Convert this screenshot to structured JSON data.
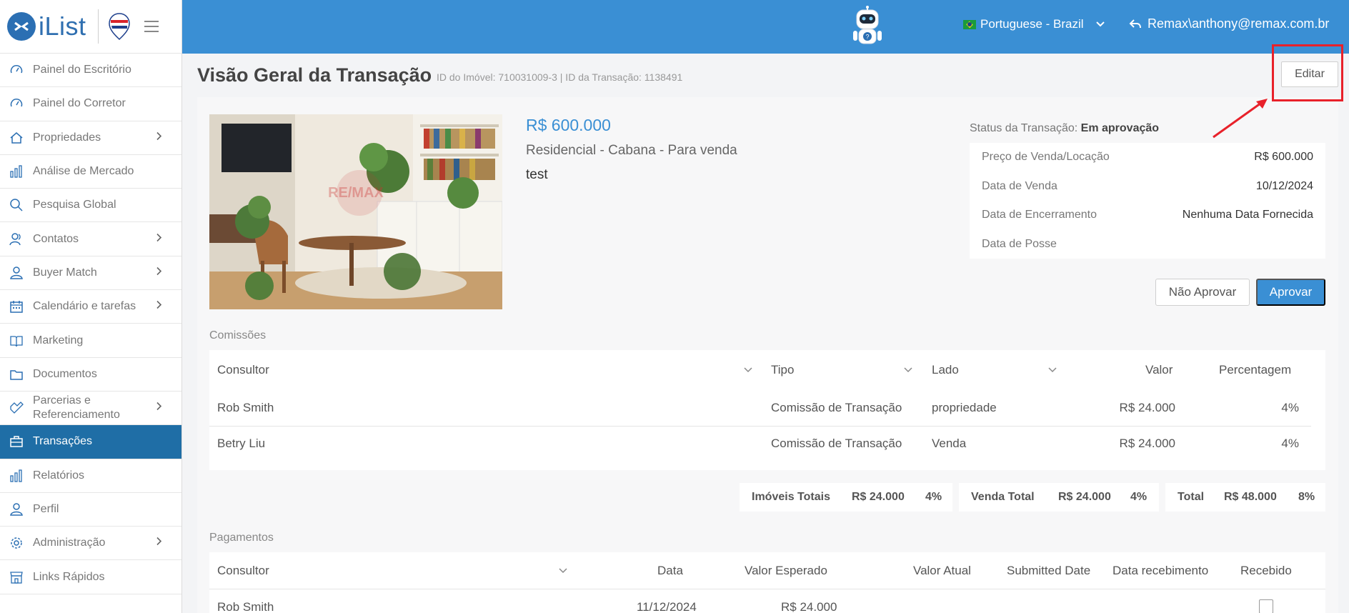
{
  "brand": {
    "logo_text": "iList"
  },
  "nav": [
    {
      "label": "Painel do Escritório",
      "icon": "gauge-icon",
      "chevron": false
    },
    {
      "label": "Painel do Corretor",
      "icon": "gauge-icon",
      "chevron": false
    },
    {
      "label": "Propriedades",
      "icon": "home-icon",
      "chevron": true
    },
    {
      "label": "Análise de Mercado",
      "icon": "bar-chart-icon",
      "chevron": false
    },
    {
      "label": "Pesquisa Global",
      "icon": "search-icon",
      "chevron": false
    },
    {
      "label": "Contatos",
      "icon": "contacts-icon",
      "chevron": true
    },
    {
      "label": "Buyer Match",
      "icon": "user-icon",
      "chevron": true
    },
    {
      "label": "Calendário e tarefas",
      "icon": "calendar-icon",
      "chevron": true
    },
    {
      "label": "Marketing",
      "icon": "book-icon",
      "chevron": false
    },
    {
      "label": "Documentos",
      "icon": "folder-icon",
      "chevron": false
    },
    {
      "label": "Parcerias e Referenciamento",
      "icon": "handshake-icon",
      "chevron": true
    },
    {
      "label": "Transações",
      "icon": "briefcase-icon",
      "chevron": false,
      "active": true
    },
    {
      "label": "Relatórios",
      "icon": "bar-chart-icon",
      "chevron": false
    },
    {
      "label": "Perfil",
      "icon": "user-icon",
      "chevron": false
    },
    {
      "label": "Administração",
      "icon": "gear-icon",
      "chevron": true
    },
    {
      "label": "Links Rápidos",
      "icon": "store-icon",
      "chevron": false
    }
  ],
  "topbar": {
    "language": "Portuguese - Brazil",
    "user": "Remax\\anthony@remax.com.br"
  },
  "header": {
    "title": "Visão Geral da Transação",
    "subtitle": "ID do Imóvel: 710031009-3 | ID da Transação: 1138491",
    "edit_label": "Editar"
  },
  "property": {
    "price": "R$ 600.000",
    "type": "Residencial - Cabana - Para venda",
    "description": "test",
    "watermark": "RE/MAX"
  },
  "status": {
    "label": "Status da Transação:",
    "value": "Em aprovação",
    "rows": [
      {
        "label": "Preço de Venda/Locação",
        "value": "R$ 600.000"
      },
      {
        "label": "Data de Venda",
        "value": "10/12/2024"
      },
      {
        "label": "Data de Encerramento",
        "value": "Nenhuma Data Fornecida"
      },
      {
        "label": "Data de Posse",
        "value": ""
      }
    ]
  },
  "actions": {
    "reject": "Não Aprovar",
    "approve": "Aprovar"
  },
  "commissions": {
    "title": "Comissões",
    "headers": {
      "consultor": "Consultor",
      "tipo": "Tipo",
      "lado": "Lado",
      "valor": "Valor",
      "percentagem": "Percentagem"
    },
    "rows": [
      {
        "consultor": "Rob Smith",
        "tipo": "Comissão de Transação",
        "lado": "propriedade",
        "valor": "R$ 24.000",
        "percentagem": "4%"
      },
      {
        "consultor": "Betry Liu",
        "tipo": "Comissão de Transação",
        "lado": "Venda",
        "valor": "R$ 24.000",
        "percentagem": "4%"
      }
    ]
  },
  "totals": {
    "imoveis": {
      "label": "Imóveis Totais",
      "value": "R$ 24.000",
      "pct": "4%"
    },
    "venda": {
      "label": "Venda Total",
      "value": "R$ 24.000",
      "pct": "4%"
    },
    "total": {
      "label": "Total",
      "value": "R$ 48.000",
      "pct": "8%"
    }
  },
  "payments": {
    "title": "Pagamentos",
    "headers": {
      "consultor": "Consultor",
      "data": "Data",
      "esperado": "Valor Esperado",
      "atual": "Valor Atual",
      "submitted": "Submitted Date",
      "recebimento": "Data recebimento",
      "recebido": "Recebido"
    },
    "rows": [
      {
        "consultor": "Rob Smith",
        "data": "11/12/2024",
        "esperado": "R$ 24.000",
        "atual": "",
        "submitted": "",
        "recebimento": "",
        "recebido": false
      }
    ]
  },
  "colors": {
    "primary": "#3a8fd4",
    "sidebar_active": "#1f6ea6",
    "highlight": "#e8212a"
  }
}
